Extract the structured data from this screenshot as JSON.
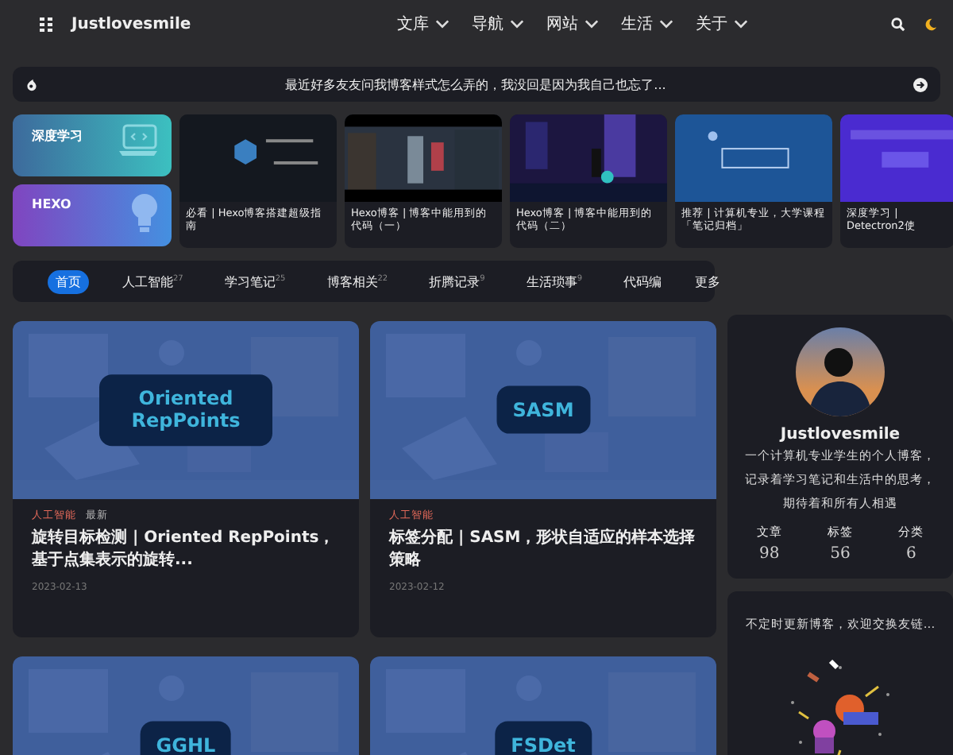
{
  "header": {
    "brand": "Justlovesmile",
    "nav": [
      "文库",
      "导航",
      "网站",
      "生活",
      "关于"
    ]
  },
  "notice": {
    "text": "最近好多友友问我博客样式怎么弄的，我没回是因为我自己也忘了..."
  },
  "categories": [
    {
      "label": "深度学习",
      "kind": "laptop"
    },
    {
      "label": "HEXO",
      "kind": "bulb"
    }
  ],
  "featured": [
    {
      "title": "必看 | Hexo博客搭建超级指南"
    },
    {
      "title": "Hexo博客 | 博客中能用到的代码（一）"
    },
    {
      "title": "Hexo博客 | 博客中能用到的代码（二）"
    },
    {
      "title": "推荐 | 计算机专业，大学课程「笔记归档」"
    },
    {
      "title": "深度学习 | Detectron2使"
    }
  ],
  "tabs": [
    {
      "label": "首页",
      "selected": true
    },
    {
      "label": "人工智能",
      "count": "27",
      "selected": false
    },
    {
      "label": "学习笔记",
      "count": "25",
      "selected": false
    },
    {
      "label": "博客相关",
      "count": "22",
      "selected": false
    },
    {
      "label": "折腾记录",
      "count": "9",
      "selected": false
    },
    {
      "label": "生活琐事",
      "count": "9",
      "selected": false
    },
    {
      "label": "代码编",
      "selected": false
    }
  ],
  "more": "更多",
  "posts": [
    {
      "cover_label": "Oriented RepPoints",
      "category": "人工智能",
      "badge": "最新",
      "title": "旋转目标检测 | Oriented RepPoints，基于点集表示的旋转...",
      "date": "2023-02-13"
    },
    {
      "cover_label": "SASM",
      "category": "人工智能",
      "title": "标签分配 | SASM，形状自适应的样本选择策略",
      "date": "2023-02-12"
    },
    {
      "cover_label": "GGHL"
    },
    {
      "cover_label": "FSDet"
    }
  ],
  "profile": {
    "name": "Justlovesmile",
    "bio": "一个计算机专业学生的个人博客，记录着学习笔记和生活中的思考，期待着和所有人相遇",
    "stats": [
      {
        "label": "文章",
        "value": "98"
      },
      {
        "label": "标签",
        "value": "56"
      },
      {
        "label": "分类",
        "value": "6"
      }
    ]
  },
  "links_card": {
    "text": "不定时更新博客，欢迎交换友链..."
  }
}
